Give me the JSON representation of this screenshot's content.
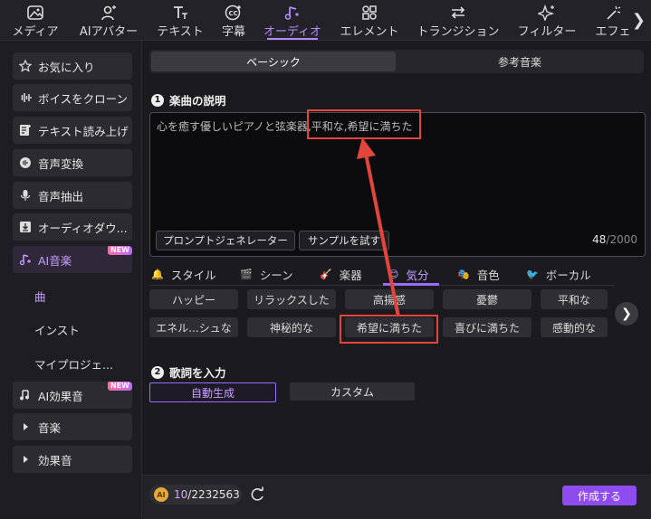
{
  "topbar": {
    "tabs": [
      {
        "label": "メディア",
        "icon": "media-icon"
      },
      {
        "label": "AIアバター",
        "icon": "avatar-icon"
      },
      {
        "label": "テキスト",
        "icon": "text-icon"
      },
      {
        "label": "字幕",
        "icon": "caption-icon"
      },
      {
        "label": "オーディオ",
        "icon": "audio-icon",
        "active": true
      },
      {
        "label": "エレメント",
        "icon": "element-icon"
      },
      {
        "label": "トランジション",
        "icon": "transition-icon"
      },
      {
        "label": "フィルター",
        "icon": "filter-icon"
      },
      {
        "label": "エフェ",
        "icon": "effect-icon"
      }
    ]
  },
  "sidebar": {
    "items": [
      {
        "label": "お気に入り",
        "icon": "star-icon"
      },
      {
        "label": "ボイスをクローン",
        "icon": "waveform-icon"
      },
      {
        "label": "テキスト読み上げ",
        "icon": "tts-icon"
      },
      {
        "label": "音声変換",
        "icon": "voice-change-icon"
      },
      {
        "label": "音声抽出",
        "icon": "microphone-icon"
      },
      {
        "label": "オーディオダウ...",
        "icon": "download-icon"
      },
      {
        "label": "AI音楽",
        "icon": "ai-music-icon",
        "badge": "NEW"
      },
      {
        "label": "AI効果音",
        "icon": "ai-sfx-icon",
        "badge": "NEW"
      },
      {
        "label": "音楽",
        "icon": "caret-right-icon"
      },
      {
        "label": "効果音",
        "icon": "caret-right-icon"
      }
    ],
    "sub_items": [
      "曲",
      "インスト",
      "マイプロジェ..."
    ]
  },
  "main": {
    "segments": [
      "ベーシック",
      "参考音楽"
    ],
    "section1": {
      "num": "1",
      "title": "楽曲の説明"
    },
    "description": "心を癒す優しいピアノと弦楽器,平和な,希望に満ちた",
    "prompt_generator": "プロンプトジェネレーター",
    "try_sample": "サンプルを試す",
    "char_count": "48",
    "char_max": "/2000",
    "categories": [
      {
        "label": "スタイル",
        "icon": "style-icon"
      },
      {
        "label": "シーン",
        "icon": "scene-icon"
      },
      {
        "label": "楽器",
        "icon": "guitar-icon"
      },
      {
        "label": "気分",
        "icon": "smile-icon",
        "active": true
      },
      {
        "label": "音色",
        "icon": "tone-icon"
      },
      {
        "label": "ボーカル",
        "icon": "vocal-icon"
      }
    ],
    "mood_chips_row1": [
      "ハッピー",
      "リラックスした",
      "高揚感",
      "憂鬱",
      "平和な"
    ],
    "mood_chips_row2": [
      "エネル...シュな",
      "神秘的な",
      "希望に満ちた",
      "喜びに満ちた",
      "感動的な"
    ],
    "section2": {
      "num": "2",
      "title": "歌詞を入力"
    },
    "lyrics_modes": [
      "自動生成",
      "カスタム"
    ],
    "credits_used": "10",
    "credits_total": "/2232563",
    "coin_label": "AI",
    "create_button": "作成する"
  },
  "colors": {
    "accent": "#b68bff",
    "create_button": "#8e4bf0",
    "highlight_box": "#e2453c"
  }
}
